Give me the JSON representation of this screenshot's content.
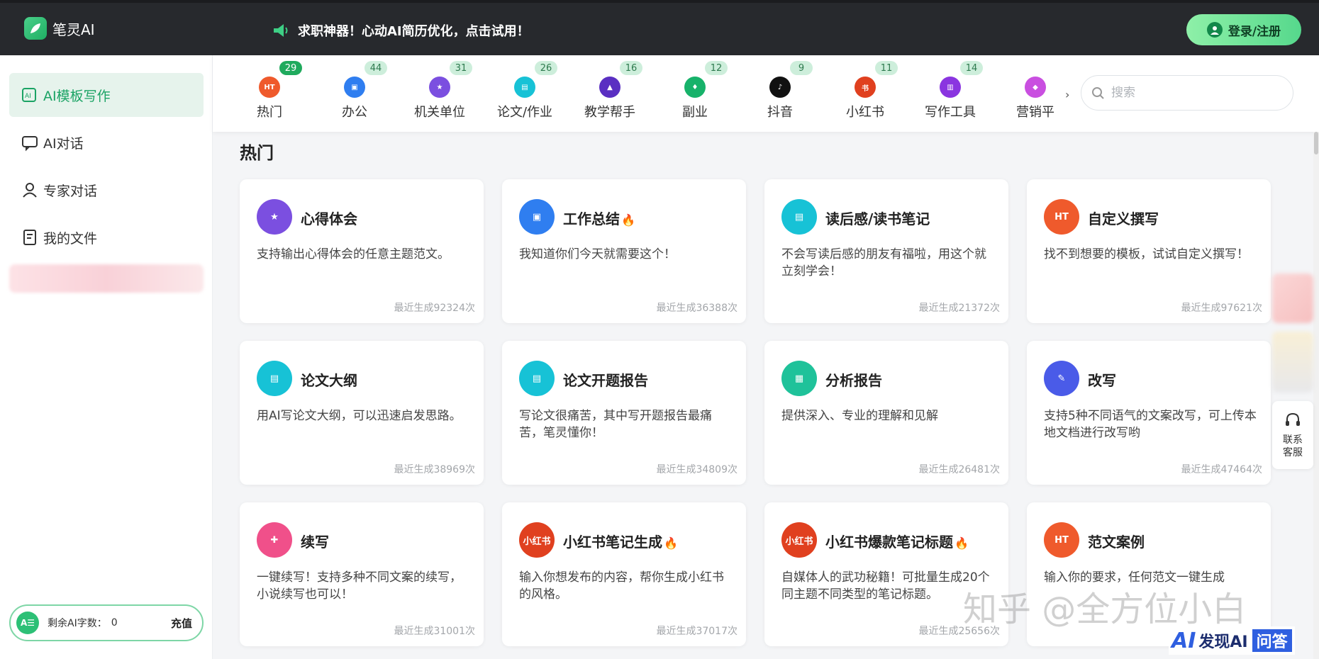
{
  "header": {
    "logo_text": "笔灵AI",
    "promo_text": "求职神器！心动AI简历优化，点击试用！",
    "login_label": "登录/注册"
  },
  "sidebar": {
    "items": [
      {
        "label": "AI模板写作",
        "icon": "ai-template-icon",
        "active": true
      },
      {
        "label": "AI对话",
        "icon": "chat-icon"
      },
      {
        "label": "专家对话",
        "icon": "expert-icon"
      },
      {
        "label": "我的文件",
        "icon": "file-icon"
      }
    ],
    "quota": {
      "badge": "A☰",
      "label": "剩余AI字数：",
      "value": "0",
      "action": "充值"
    }
  },
  "categories": [
    {
      "label": "热门",
      "count": "29",
      "color": "#ef5a2c",
      "glyph": "HT",
      "icon": "hot-flame-icon",
      "hot": true
    },
    {
      "label": "办公",
      "count": "44",
      "color": "#2f7ef0",
      "glyph": "▣",
      "icon": "briefcase-icon"
    },
    {
      "label": "机关单位",
      "count": "31",
      "color": "#7b4fe0",
      "glyph": "★",
      "icon": "star-badge-icon"
    },
    {
      "label": "论文/作业",
      "count": "26",
      "color": "#17c2d6",
      "glyph": "▤",
      "icon": "book-icon"
    },
    {
      "label": "教学帮手",
      "count": "16",
      "color": "#5a2fc2",
      "glyph": "▲",
      "icon": "graduation-cap-icon"
    },
    {
      "label": "副业",
      "count": "12",
      "color": "#17b26a",
      "glyph": "♦",
      "icon": "tie-icon"
    },
    {
      "label": "抖音",
      "count": "9",
      "color": "#111111",
      "glyph": "♪",
      "icon": "tiktok-icon"
    },
    {
      "label": "小红书",
      "count": "11",
      "color": "#e0401f",
      "glyph": "书",
      "icon": "xiaohongshu-icon"
    },
    {
      "label": "写作工具",
      "count": "14",
      "color": "#8a35e0",
      "glyph": "▥",
      "icon": "notebook-icon"
    },
    {
      "label": "营销平",
      "count": "",
      "color": "#c94fe0",
      "glyph": "◆",
      "icon": "tag-icon"
    }
  ],
  "search": {
    "placeholder": "搜索"
  },
  "section": {
    "title": "热门"
  },
  "cards": [
    {
      "title": "心得体会",
      "hot": false,
      "desc": "支持输出心得体会的任意主题范文。",
      "count": "最近生成92324次",
      "color": "#7b4fe0",
      "glyph": "★",
      "icon": "star-badge-icon"
    },
    {
      "title": "工作总结",
      "hot": true,
      "desc": "我知道你们今天就需要这个！",
      "count": "最近生成36388次",
      "color": "#2f7ef0",
      "glyph": "▣",
      "icon": "briefcase-icon"
    },
    {
      "title": "读后感/读书笔记",
      "hot": false,
      "desc": "不会写读后感的朋友有福啦，用这个就立刻学会！",
      "count": "最近生成21372次",
      "color": "#17c2d6",
      "glyph": "▤",
      "icon": "book-icon"
    },
    {
      "title": "自定义撰写",
      "hot": false,
      "desc": "找不到想要的模板，试试自定义撰写！",
      "count": "最近生成97621次",
      "color": "#ef5a2c",
      "glyph": "HT",
      "icon": "hot-flame-icon"
    },
    {
      "title": "论文大纲",
      "hot": false,
      "desc": "用AI写论文大纲，可以迅速启发思路。",
      "count": "最近生成38969次",
      "color": "#17c2d6",
      "glyph": "▤",
      "icon": "book-icon"
    },
    {
      "title": "论文开题报告",
      "hot": false,
      "desc": "写论文很痛苦，其中写开题报告最痛苦，笔灵懂你！",
      "count": "最近生成34809次",
      "color": "#17c2d6",
      "glyph": "▤",
      "icon": "book-icon"
    },
    {
      "title": "分析报告",
      "hot": false,
      "desc": "提供深入、专业的理解和见解",
      "count": "最近生成26481次",
      "color": "#1fc29a",
      "glyph": "▦",
      "icon": "document-icon"
    },
    {
      "title": "改写",
      "hot": false,
      "desc": "支持5种不同语气的文案改写，可上传本地文档进行改写哟",
      "count": "最近生成47464次",
      "color": "#4a5be8",
      "glyph": "✎",
      "icon": "feather-pen-icon"
    },
    {
      "title": "续写",
      "hot": false,
      "desc": "一键续写！支持多种不同文案的续写，小说续写也可以！",
      "count": "最近生成31001次",
      "color": "#f0508a",
      "glyph": "✚",
      "icon": "continue-writing-icon"
    },
    {
      "title": "小红书笔记生成",
      "hot": true,
      "desc": "输入你想发布的内容，帮你生成小红书的风格。",
      "count": "最近生成37017次",
      "color": "#e0401f",
      "glyph": "小红书",
      "icon": "xiaohongshu-icon"
    },
    {
      "title": "小红书爆款笔记标题",
      "hot": true,
      "desc": "自媒体人的武功秘籍！可批量生成20个同主题不同类型的笔记标题。",
      "count": "最近生成25656次",
      "color": "#e0401f",
      "glyph": "小红书",
      "icon": "xiaohongshu-icon"
    },
    {
      "title": "范文案例",
      "hot": false,
      "desc": "输入你的要求，任何范文一键生成",
      "count": "",
      "color": "#ef5a2c",
      "glyph": "HT",
      "icon": "hot-flame-icon"
    }
  ],
  "service": {
    "label": "联系客服"
  },
  "watermark": {
    "text": "知乎 @全方位小白",
    "logo_ai": "AI",
    "logo_name": "发现AI",
    "logo_qa": "问答"
  }
}
